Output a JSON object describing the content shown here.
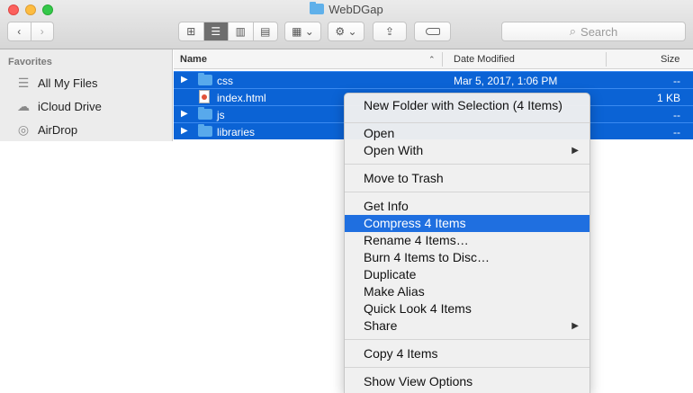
{
  "window": {
    "title": "WebDGap"
  },
  "toolbar": {
    "back_glyph": "‹",
    "forward_glyph": "›",
    "view_icons": [
      "⊞",
      "☰",
      "▥",
      "▤"
    ],
    "arrange_glyph": "▦ ⌄",
    "action_glyph": "⚙ ⌄",
    "share_glyph": "⇪",
    "search_placeholder": "Search"
  },
  "sidebar": {
    "heading": "Favorites",
    "items": [
      {
        "label": "All My Files",
        "icon": "☰"
      },
      {
        "label": "iCloud Drive",
        "icon": "☁"
      },
      {
        "label": "AirDrop",
        "icon": "◎"
      }
    ]
  },
  "columns": {
    "name": "Name",
    "sort_indicator": "⌃",
    "date": "Date Modified",
    "size": "Size"
  },
  "files": [
    {
      "name": "css",
      "date": "Mar 5, 2017, 1:06 PM",
      "size": "--",
      "kind": "folder"
    },
    {
      "name": "index.html",
      "date": "",
      "size": "1 KB",
      "kind": "file"
    },
    {
      "name": "js",
      "date": "",
      "size": "--",
      "kind": "folder"
    },
    {
      "name": "libraries",
      "date": "",
      "size": "--",
      "kind": "folder"
    }
  ],
  "context_menu": {
    "items": [
      "New Folder with Selection (4 Items)",
      "Open",
      "Open With",
      "Move to Trash",
      "Get Info",
      "Compress 4 Items",
      "Rename 4 Items…",
      "Burn 4 Items to Disc…",
      "Duplicate",
      "Make Alias",
      "Quick Look 4 Items",
      "Share",
      "Copy 4 Items",
      "Show View Options"
    ],
    "highlighted": "Compress 4 Items",
    "submenu_glyph": "▶",
    "disclosure_glyph": "▶"
  },
  "colors": {
    "selection": "#0b63d5",
    "menu_highlight": "#1f6fe0",
    "folder": "#58a9ec"
  }
}
